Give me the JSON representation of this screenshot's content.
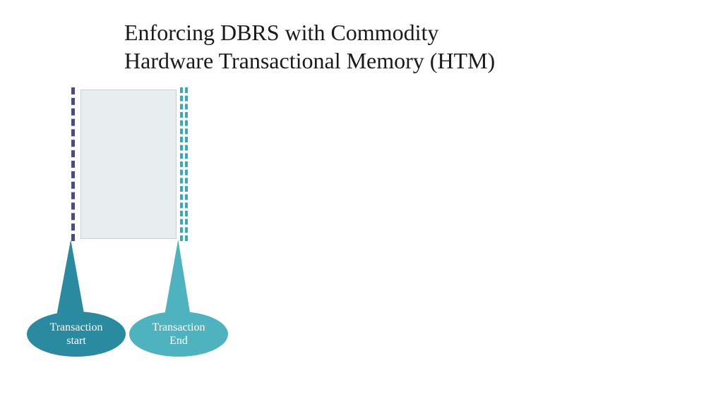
{
  "title_line1": "Enforcing DBRS with Commodity",
  "title_line2": "Hardware Transactional Memory (HTM)",
  "callouts": {
    "start": {
      "line1": "Transaction",
      "line2": "start"
    },
    "end": {
      "line1": "Transaction",
      "line2": "End"
    }
  },
  "colors": {
    "start_fill": "#2a8aa0",
    "end_fill": "#4fb3bf",
    "left_dash": "#4a4a8a",
    "right_dash": "#3aa8b8",
    "box_fill": "#e8eef0"
  }
}
